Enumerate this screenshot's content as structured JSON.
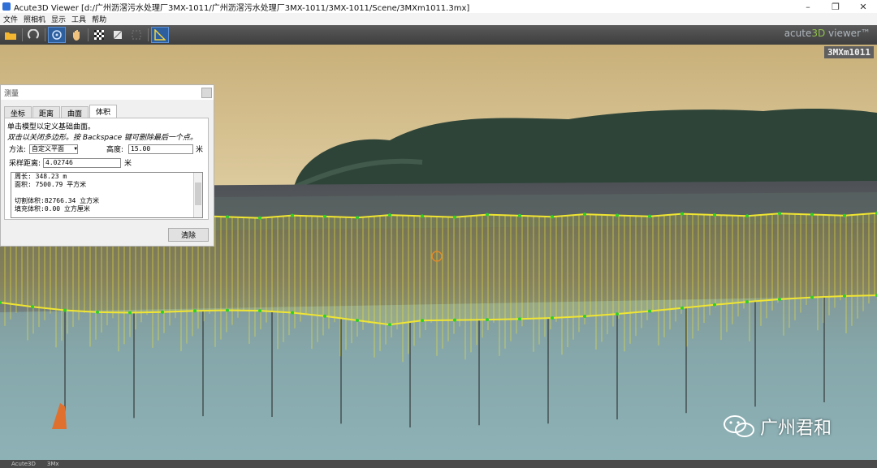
{
  "window": {
    "title": "Acute3D Viewer [d:/广州沥滘污水处理厂3MX-1011/广州沥滘污水处理厂3MX-1011/3MX-1011/Scene/3MXm1011.3mx]",
    "controls": {
      "minimize": "–",
      "maximize": "❐",
      "close": "✕"
    }
  },
  "menu": [
    "文件",
    "照相机",
    "显示",
    "工具",
    "帮助"
  ],
  "toolbar": {
    "brand_prefix": "acute",
    "brand_accent": "3D",
    "brand_suffix": " viewer™",
    "tools": [
      "open-folder-icon",
      "reset-view-icon",
      "orbit-icon",
      "pan-hand-icon",
      "checker-icon",
      "square-icon",
      "grid-icon",
      "measure-ruler-icon"
    ]
  },
  "viewport": {
    "scene_name": "3MXm1011"
  },
  "measure_panel": {
    "title": "测量",
    "tabs": [
      "坐标",
      "距离",
      "曲面",
      "体积"
    ],
    "active_tab": "体积",
    "instruction1": "单击模型以定义基础曲面。",
    "instruction2": "双击以关闭多边形。按 Backspace 键可删除最后一个点。",
    "method_label": "方法:",
    "method_value": "自定义平面",
    "height_label": "高度:",
    "height_value": "15.00",
    "height_unit": "米",
    "sample_label": "采样距离:",
    "sample_value": "4.02746",
    "sample_unit": "米",
    "results": [
      "周长:     348.23 m",
      "面积:     7500.79 平方米",
      "",
      "切割体积:82766.34 立方米",
      "填充体积:0.00 立方厘米"
    ],
    "clear_button": "清除"
  },
  "watermark": {
    "text": "广州君和"
  },
  "statusbar": {
    "left": "Acute3D",
    "right": "3Mx"
  },
  "colors": {
    "accent": "#8fc24a",
    "measure_line": "#f0e532",
    "measure_point": "#2bd12b"
  }
}
